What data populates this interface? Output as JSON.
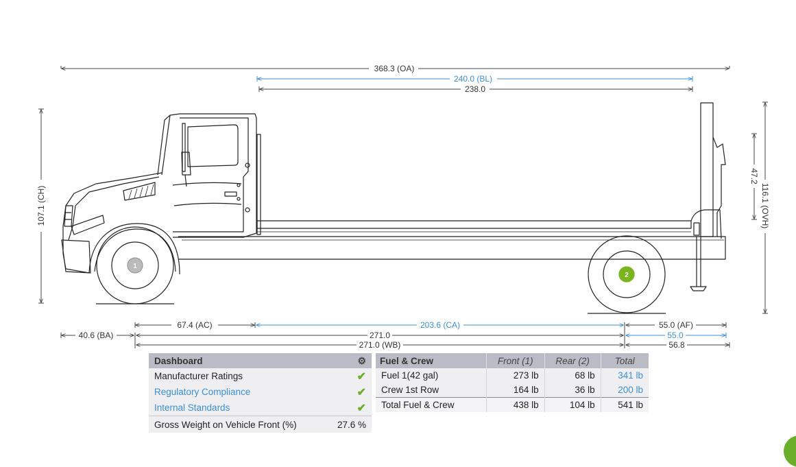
{
  "dimensions": {
    "oa": "368.3 (OA)",
    "bl": "240.0 (BL)",
    "body_len": "238.0",
    "ch": "107.1 (CH)",
    "ovh": "116.1 (OVH)",
    "h47": "47.2",
    "ac": "67.4 (AC)",
    "ca": "203.6 (CA)",
    "af": "55.0 (AF)",
    "ba": "40.6 (BA)",
    "d271": "271.0",
    "af2": "55.0",
    "wb": "271.0 (WB)",
    "d568": "56.8"
  },
  "axles": {
    "front": "1",
    "rear": "2"
  },
  "colors": {
    "accent_blue": "#3a8fd6",
    "check_green": "#6aae2a",
    "rear_axle_green": "#7ab51d",
    "header_gray": "#b9bcc4"
  },
  "dashboard": {
    "title": "Dashboard",
    "settings_icon": "gear-icon",
    "items": [
      {
        "label": "Manufacturer Ratings",
        "status_icon": "check-icon"
      },
      {
        "label": "Regulatory Compliance",
        "status_icon": "check-icon"
      },
      {
        "label": "Internal Standards",
        "status_icon": "check-icon"
      }
    ],
    "gross_weight_label": "Gross Weight on Vehicle Front (%)",
    "gross_weight_value": "27.6 %"
  },
  "fuel_crew": {
    "headers": [
      "Fuel & Crew",
      "Front (1)",
      "Rear (2)",
      "Total"
    ],
    "rows": [
      [
        "Fuel 1(42 gal)",
        "273 lb",
        "68 lb",
        "341 lb"
      ],
      [
        "Crew 1st Row",
        "164 lb",
        "36 lb",
        "200 lb"
      ],
      [
        "Total Fuel & Crew",
        "438 lb",
        "104 lb",
        "541 lb"
      ]
    ]
  }
}
